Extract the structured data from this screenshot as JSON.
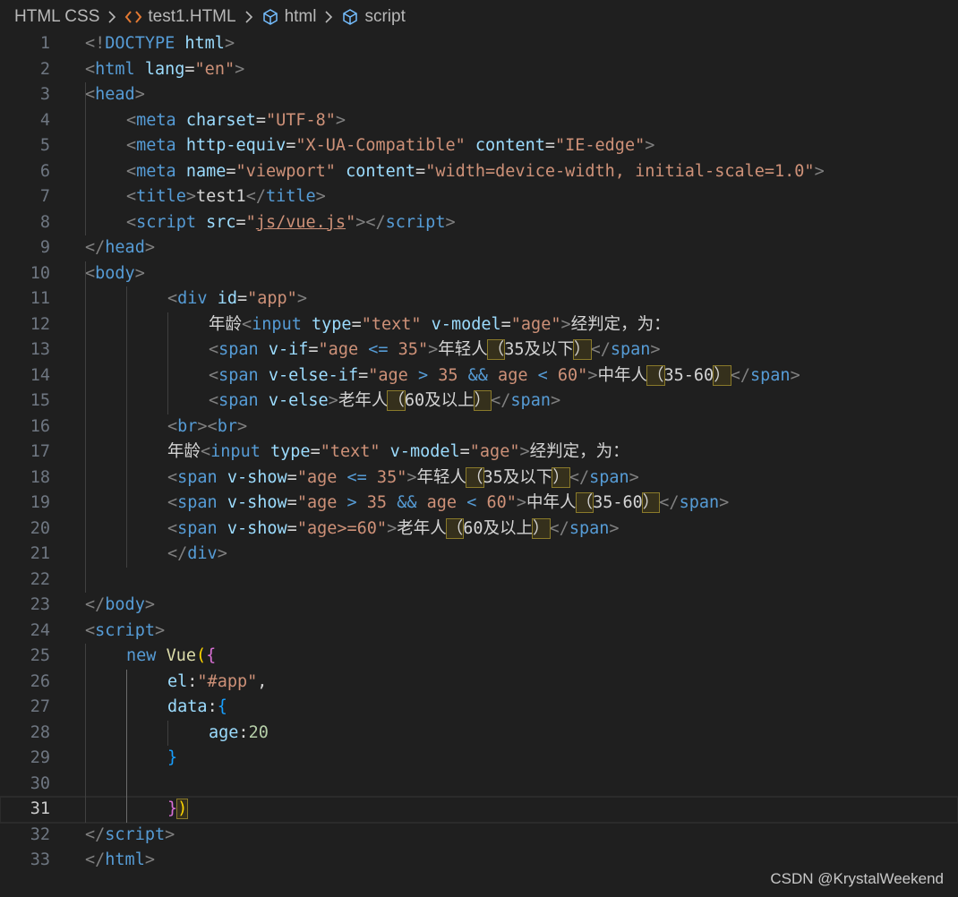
{
  "breadcrumb": {
    "folder": "HTML CSS",
    "file": "test1.HTML",
    "node1": "html",
    "node2": "script"
  },
  "watermark": "CSDN @KrystalWeekend",
  "colors": {
    "background": "#1f1f1f",
    "tag": "#569cd6",
    "attribute": "#9cdcfe",
    "string": "#ce9178",
    "punctuation": "#808080",
    "file_icon": "#e37933"
  },
  "editor": {
    "current_line": 31,
    "lines": [
      {
        "n": "1",
        "indent": 0,
        "tokens": [
          [
            "punc",
            "<!"
          ],
          [
            "tag",
            "DOCTYPE"
          ],
          [
            "text",
            " "
          ],
          [
            "attr",
            "html"
          ],
          [
            "punc",
            ">"
          ]
        ]
      },
      {
        "n": "2",
        "indent": 0,
        "tokens": [
          [
            "punc",
            "<"
          ],
          [
            "tag",
            "html"
          ],
          [
            "text",
            " "
          ],
          [
            "attr",
            "lang"
          ],
          [
            "text",
            "="
          ],
          [
            "str",
            "\"en\""
          ],
          [
            "punc",
            ">"
          ]
        ]
      },
      {
        "n": "3",
        "indent": 0,
        "tokens": [
          [
            "punc",
            "<"
          ],
          [
            "tag",
            "head"
          ],
          [
            "punc",
            ">"
          ]
        ]
      },
      {
        "n": "4",
        "indent": 1,
        "tokens": [
          [
            "punc",
            "<"
          ],
          [
            "tag",
            "meta"
          ],
          [
            "text",
            " "
          ],
          [
            "attr",
            "charset"
          ],
          [
            "text",
            "="
          ],
          [
            "str",
            "\"UTF-8\""
          ],
          [
            "punc",
            ">"
          ]
        ]
      },
      {
        "n": "5",
        "indent": 1,
        "tokens": [
          [
            "punc",
            "<"
          ],
          [
            "tag",
            "meta"
          ],
          [
            "text",
            " "
          ],
          [
            "attr",
            "http-equiv"
          ],
          [
            "text",
            "="
          ],
          [
            "str",
            "\"X-UA-Compatible\""
          ],
          [
            "text",
            " "
          ],
          [
            "attr",
            "content"
          ],
          [
            "text",
            "="
          ],
          [
            "str",
            "\"IE-edge\""
          ],
          [
            "punc",
            ">"
          ]
        ]
      },
      {
        "n": "6",
        "indent": 1,
        "tokens": [
          [
            "punc",
            "<"
          ],
          [
            "tag",
            "meta"
          ],
          [
            "text",
            " "
          ],
          [
            "attr",
            "name"
          ],
          [
            "text",
            "="
          ],
          [
            "str",
            "\"viewport\""
          ],
          [
            "text",
            " "
          ],
          [
            "attr",
            "content"
          ],
          [
            "text",
            "="
          ],
          [
            "str",
            "\"width=device-width, initial-scale=1.0\""
          ],
          [
            "punc",
            ">"
          ]
        ]
      },
      {
        "n": "7",
        "indent": 1,
        "tokens": [
          [
            "punc",
            "<"
          ],
          [
            "tag",
            "title"
          ],
          [
            "punc",
            ">"
          ],
          [
            "text",
            "test1"
          ],
          [
            "punc",
            "</"
          ],
          [
            "tag",
            "title"
          ],
          [
            "punc",
            ">"
          ]
        ]
      },
      {
        "n": "8",
        "indent": 1,
        "tokens": [
          [
            "punc",
            "<"
          ],
          [
            "tag",
            "script"
          ],
          [
            "text",
            " "
          ],
          [
            "attr",
            "src"
          ],
          [
            "text",
            "="
          ],
          [
            "str",
            "\""
          ],
          [
            "strul",
            "js/vue.js"
          ],
          [
            "str",
            "\""
          ],
          [
            "punc",
            "></"
          ],
          [
            "tag",
            "script"
          ],
          [
            "punc",
            ">"
          ]
        ]
      },
      {
        "n": "9",
        "indent": 0,
        "tokens": [
          [
            "punc",
            "</"
          ],
          [
            "tag",
            "head"
          ],
          [
            "punc",
            ">"
          ]
        ]
      },
      {
        "n": "10",
        "indent": 0,
        "tokens": [
          [
            "punc",
            "<"
          ],
          [
            "tag",
            "body"
          ],
          [
            "punc",
            ">"
          ]
        ]
      },
      {
        "n": "11",
        "indent": 2,
        "tokens": [
          [
            "punc",
            "<"
          ],
          [
            "tag",
            "div"
          ],
          [
            "text",
            " "
          ],
          [
            "attr",
            "id"
          ],
          [
            "text",
            "="
          ],
          [
            "str",
            "\"app\""
          ],
          [
            "punc",
            ">"
          ]
        ]
      },
      {
        "n": "12",
        "indent": 3,
        "tokens": [
          [
            "text",
            "年龄"
          ],
          [
            "punc",
            "<"
          ],
          [
            "tag",
            "input"
          ],
          [
            "text",
            " "
          ],
          [
            "attr",
            "type"
          ],
          [
            "text",
            "="
          ],
          [
            "str",
            "\"text\""
          ],
          [
            "text",
            " "
          ],
          [
            "attr",
            "v-model"
          ],
          [
            "text",
            "="
          ],
          [
            "str",
            "\"age\""
          ],
          [
            "punc",
            ">"
          ],
          [
            "text",
            "经判定，为："
          ]
        ]
      },
      {
        "n": "13",
        "indent": 3,
        "tokens": [
          [
            "punc",
            "<"
          ],
          [
            "tag",
            "span"
          ],
          [
            "text",
            " "
          ],
          [
            "attr",
            "v-if"
          ],
          [
            "text",
            "="
          ],
          [
            "str",
            "\"age "
          ],
          [
            "tag",
            "<="
          ],
          [
            "str",
            " 35\""
          ],
          [
            "punc",
            ">"
          ],
          [
            "text",
            "年轻人"
          ],
          [
            "hl",
            "（"
          ],
          [
            "text",
            "35及以下"
          ],
          [
            "hl",
            "）"
          ],
          [
            "punc",
            "</"
          ],
          [
            "tag",
            "span"
          ],
          [
            "punc",
            ">"
          ]
        ]
      },
      {
        "n": "14",
        "indent": 3,
        "tokens": [
          [
            "punc",
            "<"
          ],
          [
            "tag",
            "span"
          ],
          [
            "text",
            " "
          ],
          [
            "attr",
            "v-else-if"
          ],
          [
            "text",
            "="
          ],
          [
            "str",
            "\"age "
          ],
          [
            "tag",
            ">"
          ],
          [
            "str",
            " 35 "
          ],
          [
            "tag",
            "&&"
          ],
          [
            "str",
            " age "
          ],
          [
            "tag",
            "<"
          ],
          [
            "str",
            " 60\""
          ],
          [
            "punc",
            ">"
          ],
          [
            "text",
            "中年人"
          ],
          [
            "hl",
            "（"
          ],
          [
            "text",
            "35-60"
          ],
          [
            "hl",
            "）"
          ],
          [
            "punc",
            "</"
          ],
          [
            "tag",
            "span"
          ],
          [
            "punc",
            ">"
          ]
        ]
      },
      {
        "n": "15",
        "indent": 3,
        "tokens": [
          [
            "punc",
            "<"
          ],
          [
            "tag",
            "span"
          ],
          [
            "text",
            " "
          ],
          [
            "attr",
            "v-else"
          ],
          [
            "punc",
            ">"
          ],
          [
            "text",
            "老年人"
          ],
          [
            "hl",
            "（"
          ],
          [
            "text",
            "60及以上"
          ],
          [
            "hl",
            "）"
          ],
          [
            "punc",
            "</"
          ],
          [
            "tag",
            "span"
          ],
          [
            "punc",
            ">"
          ]
        ]
      },
      {
        "n": "16",
        "indent": 2,
        "tokens": [
          [
            "punc",
            "<"
          ],
          [
            "tag",
            "br"
          ],
          [
            "punc",
            "><"
          ],
          [
            "tag",
            "br"
          ],
          [
            "punc",
            ">"
          ]
        ]
      },
      {
        "n": "17",
        "indent": 2,
        "tokens": [
          [
            "text",
            "年龄"
          ],
          [
            "punc",
            "<"
          ],
          [
            "tag",
            "input"
          ],
          [
            "text",
            " "
          ],
          [
            "attr",
            "type"
          ],
          [
            "text",
            "="
          ],
          [
            "str",
            "\"text\""
          ],
          [
            "text",
            " "
          ],
          [
            "attr",
            "v-model"
          ],
          [
            "text",
            "="
          ],
          [
            "str",
            "\"age\""
          ],
          [
            "punc",
            ">"
          ],
          [
            "text",
            "经判定，为："
          ]
        ]
      },
      {
        "n": "18",
        "indent": 2,
        "tokens": [
          [
            "punc",
            "<"
          ],
          [
            "tag",
            "span"
          ],
          [
            "text",
            " "
          ],
          [
            "attr",
            "v-show"
          ],
          [
            "text",
            "="
          ],
          [
            "str",
            "\"age "
          ],
          [
            "tag",
            "<="
          ],
          [
            "str",
            " 35\""
          ],
          [
            "punc",
            ">"
          ],
          [
            "text",
            "年轻人"
          ],
          [
            "hl",
            "（"
          ],
          [
            "text",
            "35及以下"
          ],
          [
            "hl",
            "）"
          ],
          [
            "punc",
            "</"
          ],
          [
            "tag",
            "span"
          ],
          [
            "punc",
            ">"
          ]
        ]
      },
      {
        "n": "19",
        "indent": 2,
        "tokens": [
          [
            "punc",
            "<"
          ],
          [
            "tag",
            "span"
          ],
          [
            "text",
            " "
          ],
          [
            "attr",
            "v-show"
          ],
          [
            "text",
            "="
          ],
          [
            "str",
            "\"age "
          ],
          [
            "tag",
            ">"
          ],
          [
            "str",
            " 35 "
          ],
          [
            "tag",
            "&&"
          ],
          [
            "str",
            " age "
          ],
          [
            "tag",
            "<"
          ],
          [
            "str",
            " 60\""
          ],
          [
            "punc",
            ">"
          ],
          [
            "text",
            "中年人"
          ],
          [
            "hl",
            "（"
          ],
          [
            "text",
            "35-60"
          ],
          [
            "hl",
            "）"
          ],
          [
            "punc",
            "</"
          ],
          [
            "tag",
            "span"
          ],
          [
            "punc",
            ">"
          ]
        ]
      },
      {
        "n": "20",
        "indent": 2,
        "tokens": [
          [
            "punc",
            "<"
          ],
          [
            "tag",
            "span"
          ],
          [
            "text",
            " "
          ],
          [
            "attr",
            "v-show"
          ],
          [
            "text",
            "="
          ],
          [
            "str",
            "\"age>=60\""
          ],
          [
            "punc",
            ">"
          ],
          [
            "text",
            "老年人"
          ],
          [
            "hl",
            "（"
          ],
          [
            "text",
            "60及以上"
          ],
          [
            "hl",
            "）"
          ],
          [
            "punc",
            "</"
          ],
          [
            "tag",
            "span"
          ],
          [
            "punc",
            ">"
          ]
        ]
      },
      {
        "n": "21",
        "indent": 2,
        "tokens": [
          [
            "punc",
            "</"
          ],
          [
            "tag",
            "div"
          ],
          [
            "punc",
            ">"
          ]
        ]
      },
      {
        "n": "22",
        "indent": 0,
        "tokens": []
      },
      {
        "n": "23",
        "indent": 0,
        "tokens": [
          [
            "punc",
            "</"
          ],
          [
            "tag",
            "body"
          ],
          [
            "punc",
            ">"
          ]
        ]
      },
      {
        "n": "24",
        "indent": 0,
        "tokens": [
          [
            "punc",
            "<"
          ],
          [
            "tag",
            "script"
          ],
          [
            "punc",
            ">"
          ]
        ]
      },
      {
        "n": "25",
        "indent": 1,
        "tokens": [
          [
            "kw",
            "new"
          ],
          [
            "text",
            " "
          ],
          [
            "cls",
            "Vue"
          ],
          [
            "br0",
            "("
          ],
          [
            "br1",
            "{"
          ]
        ]
      },
      {
        "n": "26",
        "indent": 2,
        "tokens": [
          [
            "attr",
            "el"
          ],
          [
            "text",
            ":"
          ],
          [
            "str",
            "\"#app\""
          ],
          [
            "text",
            ","
          ]
        ]
      },
      {
        "n": "27",
        "indent": 2,
        "tokens": [
          [
            "attr",
            "data"
          ],
          [
            "text",
            ":"
          ],
          [
            "br2",
            "{"
          ]
        ]
      },
      {
        "n": "28",
        "indent": 3,
        "tokens": [
          [
            "attr",
            "age"
          ],
          [
            "text",
            ":"
          ],
          [
            "num",
            "20"
          ]
        ]
      },
      {
        "n": "29",
        "indent": 2,
        "tokens": [
          [
            "br2",
            "}"
          ]
        ]
      },
      {
        "n": "30",
        "indent": 0,
        "tokens": []
      },
      {
        "n": "31",
        "indent": 2,
        "tokens": [
          [
            "br1",
            "}"
          ],
          [
            "br0hl",
            ")"
          ]
        ]
      },
      {
        "n": "32",
        "indent": 0,
        "tokens": [
          [
            "punc",
            "</"
          ],
          [
            "tag",
            "script"
          ],
          [
            "punc",
            ">"
          ]
        ]
      },
      {
        "n": "33",
        "indent": 0,
        "tokens": [
          [
            "punc",
            "</"
          ],
          [
            "tag",
            "html"
          ],
          [
            "punc",
            ">"
          ]
        ]
      }
    ]
  }
}
